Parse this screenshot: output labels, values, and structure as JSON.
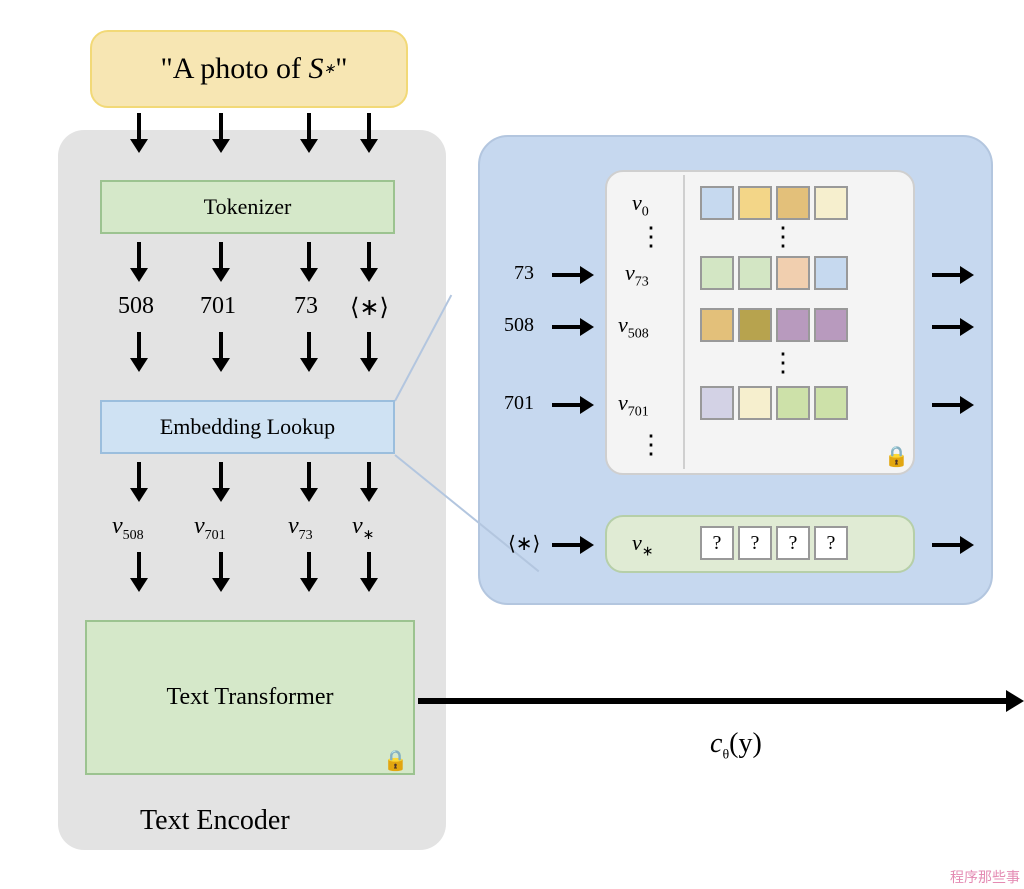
{
  "prompt": {
    "text": "\"A photo of S*\""
  },
  "blocks": {
    "tokenizer": "Tokenizer",
    "embedding": "Embedding Lookup",
    "transformer": "Text Transformer",
    "encoder_label": "Text Encoder"
  },
  "tokens": {
    "t0": "508",
    "t1": "701",
    "t2": "73",
    "t3": "⟨∗⟩"
  },
  "embeds": {
    "e0": "v",
    "e0s": "508",
    "e1": "v",
    "e1s": "701",
    "e2": "v",
    "e2s": "73",
    "e3": "v",
    "e3s": "∗"
  },
  "output": {
    "c": "c",
    "theta": "θ",
    "arg": "(y)"
  },
  "table": {
    "r0": {
      "v": "v",
      "s": "0"
    },
    "r1": {
      "v": "v",
      "s": "73"
    },
    "r2": {
      "v": "v",
      "s": "508"
    },
    "r3": {
      "v": "v",
      "s": "701"
    },
    "rstar": {
      "v": "v",
      "s": "∗"
    },
    "in0": "73",
    "in1": "508",
    "in2": "701",
    "instar": "⟨∗⟩",
    "q": "?"
  },
  "colors": {
    "c_blue": "#c6d9ef",
    "c_yellow": "#f3d688",
    "c_orange": "#e3c07a",
    "c_green": "#d3e6c4",
    "c_peach": "#f1cfaf",
    "c_purple": "#b89abe",
    "c_olive": "#b7a34e",
    "c_lime": "#cde1a9",
    "c_cream": "#f6efce",
    "c_lav": "#d3d2e5",
    "c_white": "#ffffff"
  },
  "watermark": "程序那些事"
}
